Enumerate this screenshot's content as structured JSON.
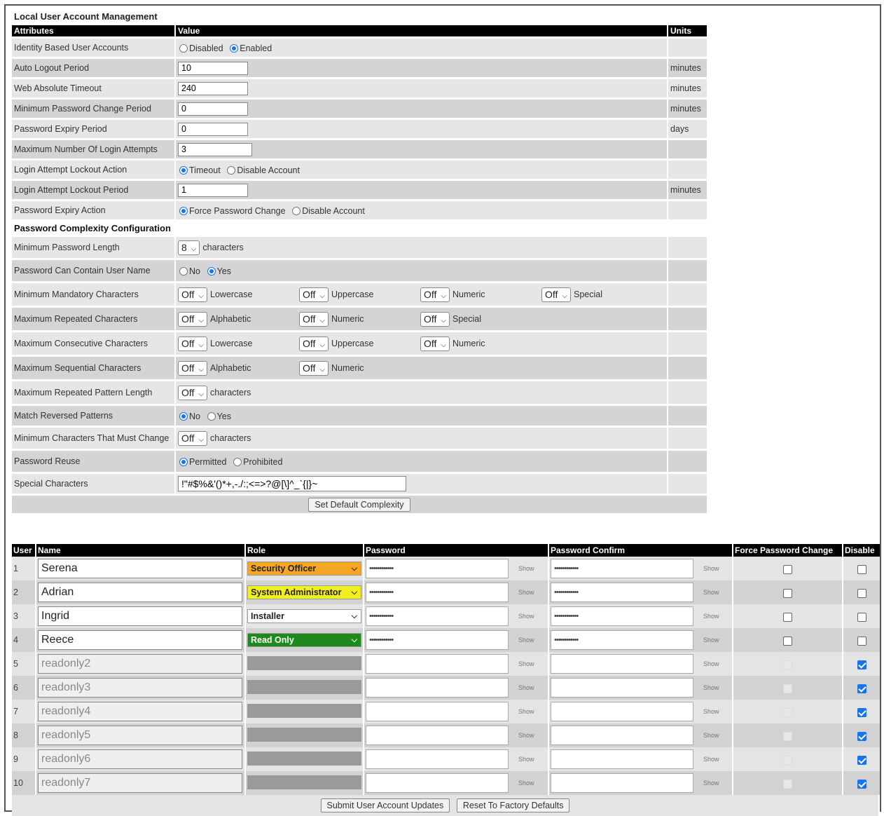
{
  "title": "Local User Account Management",
  "headers": {
    "attributes": "Attributes",
    "value": "Value",
    "units": "Units"
  },
  "rows": {
    "identity": {
      "label": "Identity Based User Accounts",
      "opt1": "Disabled",
      "opt2": "Enabled",
      "selected": "Enabled"
    },
    "auto_logout": {
      "label": "Auto Logout Period",
      "value": "10",
      "units": "minutes"
    },
    "web_timeout": {
      "label": "Web Absolute Timeout",
      "value": "240",
      "units": "minutes"
    },
    "min_pw_change": {
      "label": "Minimum Password Change Period",
      "value": "0",
      "units": "minutes"
    },
    "pw_expiry": {
      "label": "Password Expiry Period",
      "value": "0",
      "units": "days"
    },
    "max_login": {
      "label": "Maximum Number Of Login Attempts",
      "value": "3"
    },
    "lockout_action": {
      "label": "Login Attempt Lockout Action",
      "opt1": "Timeout",
      "opt2": "Disable Account",
      "selected": "Timeout"
    },
    "lockout_period": {
      "label": "Login Attempt Lockout Period",
      "value": "1",
      "units": "minutes"
    },
    "expiry_action": {
      "label": "Password Expiry Action",
      "opt1": "Force Password Change",
      "opt2": "Disable Account",
      "selected": "Force Password Change"
    }
  },
  "complexity": {
    "section_title": "Password Complexity Configuration",
    "min_length": {
      "label": "Minimum Password Length",
      "value": "8",
      "suffix": "characters"
    },
    "contain_user": {
      "label": "Password Can Contain User Name",
      "opt1": "No",
      "opt2": "Yes",
      "selected": "Yes"
    },
    "min_mandatory": {
      "label": "Minimum Mandatory Characters",
      "v": "Off",
      "l1": "Lowercase",
      "l2": "Uppercase",
      "l3": "Numeric",
      "l4": "Special"
    },
    "max_repeated": {
      "label": "Maximum Repeated Characters",
      "v": "Off",
      "l1": "Alphabetic",
      "l2": "Numeric",
      "l3": "Special"
    },
    "max_consecutive": {
      "label": "Maximum Consecutive Characters",
      "v": "Off",
      "l1": "Lowercase",
      "l2": "Uppercase",
      "l3": "Numeric"
    },
    "max_sequential": {
      "label": "Maximum Sequential Characters",
      "v": "Off",
      "l1": "Alphabetic",
      "l2": "Numeric"
    },
    "max_pattern": {
      "label": "Maximum Repeated Pattern Length",
      "v": "Off",
      "suffix": "characters"
    },
    "match_reversed": {
      "label": "Match Reversed Patterns",
      "opt1": "No",
      "opt2": "Yes",
      "selected": "No"
    },
    "min_change": {
      "label": "Minimum Characters That Must Change",
      "v": "Off",
      "suffix": "characters"
    },
    "reuse": {
      "label": "Password Reuse",
      "opt1": "Permitted",
      "opt2": "Prohibited",
      "selected": "Permitted"
    },
    "special": {
      "label": "Special Characters",
      "value": "!\"#$%&'()*+,-./:;<=>?@[\\]^_`{|}~"
    },
    "set_default": "Set Default Complexity"
  },
  "users": {
    "headers": {
      "user": "User",
      "name": "Name",
      "role": "Role",
      "password": "Password",
      "confirm": "Password Confirm",
      "force": "Force Password Change",
      "disable": "Disable"
    },
    "show_label": "Show",
    "rows": [
      {
        "num": "1",
        "name": "Serena",
        "role": "Security Officer",
        "role_color": "#f5a623",
        "pw": "••••••••••••",
        "pwc": "••••••••••••",
        "disabled": false
      },
      {
        "num": "2",
        "name": "Adrian",
        "role": "System Administrator",
        "role_color": "#f0f020",
        "pw": "••••••••••••",
        "pwc": "••••••••••••",
        "disabled": false
      },
      {
        "num": "3",
        "name": "Ingrid",
        "role": "Installer",
        "role_color": "#ffffff",
        "pw": "••••••••••••",
        "pwc": "••••••••••••",
        "disabled": false
      },
      {
        "num": "4",
        "name": "Reece",
        "role": "Read Only",
        "role_color": "#1e8a1e",
        "pw": "••••••••••••",
        "pwc": "••••••••••••",
        "disabled": false
      },
      {
        "num": "5",
        "name": "readonly2",
        "role": "",
        "role_color": "#9a9a9a",
        "pw": "",
        "pwc": "",
        "disabled": true
      },
      {
        "num": "6",
        "name": "readonly3",
        "role": "",
        "role_color": "#9a9a9a",
        "pw": "",
        "pwc": "",
        "disabled": true
      },
      {
        "num": "7",
        "name": "readonly4",
        "role": "",
        "role_color": "#9a9a9a",
        "pw": "",
        "pwc": "",
        "disabled": true
      },
      {
        "num": "8",
        "name": "readonly5",
        "role": "",
        "role_color": "#9a9a9a",
        "pw": "",
        "pwc": "",
        "disabled": true
      },
      {
        "num": "9",
        "name": "readonly6",
        "role": "",
        "role_color": "#9a9a9a",
        "pw": "",
        "pwc": "",
        "disabled": true
      },
      {
        "num": "10",
        "name": "readonly7",
        "role": "",
        "role_color": "#9a9a9a",
        "pw": "",
        "pwc": "",
        "disabled": true
      }
    ],
    "submit": "Submit User Account Updates",
    "reset": "Reset To Factory Defaults"
  }
}
